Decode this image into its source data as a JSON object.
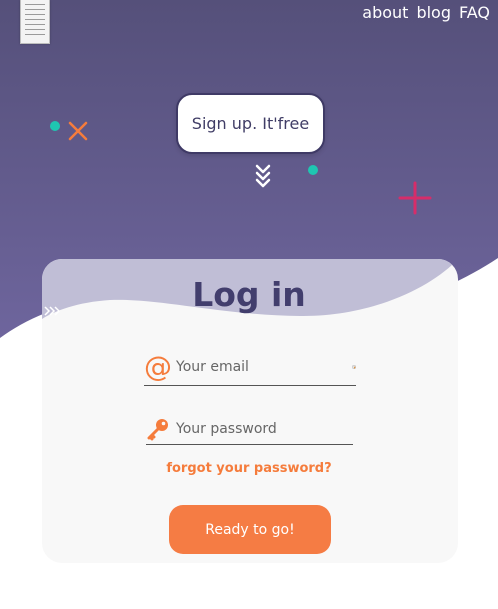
{
  "colors": {
    "hero_top": "#57527c",
    "hero_bottom": "#6c639b",
    "accent": "#f57c3c",
    "teal": "#1fc6b1",
    "magenta": "#d62d6a",
    "title": "#423e6d"
  },
  "nav": {
    "items": [
      {
        "label": "about"
      },
      {
        "label": "blog"
      },
      {
        "label": "FAQ"
      }
    ]
  },
  "hero": {
    "signup_label": "Sign up. It'free",
    "decorations": [
      "teal-dot-icon",
      "cross-icon",
      "teal-dot-icon",
      "plus-icon",
      "chevrons-down-icon",
      "chevrons-right-icon"
    ]
  },
  "login": {
    "title": "Log in",
    "email": {
      "placeholder": "Your email",
      "value": "",
      "icon": "at-icon",
      "trailing_icon": "password-manager-icon"
    },
    "password": {
      "placeholder": "Your password",
      "value": "",
      "icon": "key-icon"
    },
    "forgot_label": "forgot your password?",
    "submit_label": "Ready to go!"
  }
}
